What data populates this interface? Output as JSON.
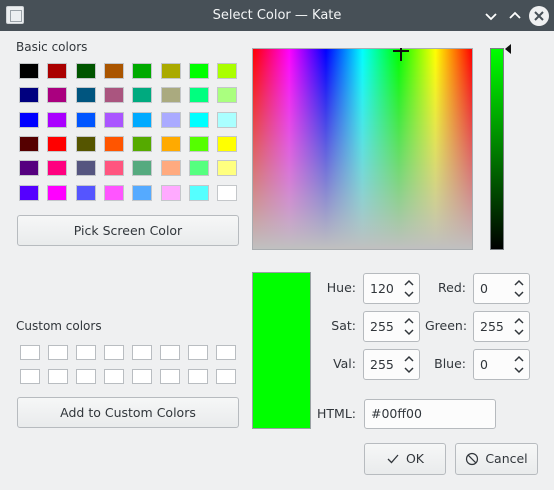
{
  "window": {
    "title": "Select Color — Kate"
  },
  "basic_colors": {
    "title": "Basic colors",
    "rows": [
      [
        "#000000",
        "#aa0000",
        "#005500",
        "#aa5500",
        "#00aa00",
        "#aaaa00",
        "#00ff00",
        "#aaff00"
      ],
      [
        "#00007f",
        "#aa007f",
        "#00557f",
        "#aa557f",
        "#00aa7f",
        "#aaaa7f",
        "#00ff7f",
        "#aaff7f"
      ],
      [
        "#0000ff",
        "#aa00ff",
        "#0055ff",
        "#aa55ff",
        "#00aaff",
        "#aaaaff",
        "#00ffff",
        "#aaffff"
      ],
      [
        "#550000",
        "#ff0000",
        "#555500",
        "#ff5500",
        "#55aa00",
        "#ffaa00",
        "#55ff00",
        "#ffff00"
      ],
      [
        "#55007f",
        "#ff007f",
        "#55557f",
        "#ff557f",
        "#55aa7f",
        "#ffaa7f",
        "#55ff7f",
        "#ffff7f"
      ],
      [
        "#5500ff",
        "#ff00ff",
        "#5555ff",
        "#ff55ff",
        "#55aaff",
        "#ffaaff",
        "#55ffff",
        "#ffffff"
      ]
    ],
    "pick_button": "Pick Screen Color"
  },
  "custom_colors": {
    "title": "Custom colors",
    "rows": [
      [
        "#ffffff",
        "#ffffff",
        "#ffffff",
        "#ffffff",
        "#ffffff",
        "#ffffff",
        "#ffffff",
        "#ffffff"
      ],
      [
        "#ffffff",
        "#ffffff",
        "#ffffff",
        "#ffffff",
        "#ffffff",
        "#ffffff",
        "#ffffff",
        "#ffffff"
      ]
    ],
    "add_button": "Add to Custom Colors"
  },
  "current_color": "#00ff00",
  "fields": {
    "hue": {
      "label": "Hue:",
      "value": "120"
    },
    "sat": {
      "label": "Sat:",
      "value": "255"
    },
    "val": {
      "label": "Val:",
      "value": "255"
    },
    "red": {
      "label": "Red:",
      "value": "0"
    },
    "green": {
      "label": "Green:",
      "value": "255"
    },
    "blue": {
      "label": "Blue:",
      "value": "0"
    },
    "html": {
      "label": "HTML:",
      "value": "#00ff00"
    }
  },
  "buttons": {
    "ok": "OK",
    "cancel": "Cancel"
  },
  "icons": {
    "app": "window-icon",
    "minimize": "chevron-down-icon",
    "maximize": "chevron-up-icon",
    "close": "close-icon",
    "ok": "checkmark-icon",
    "cancel": "cancel-icon"
  }
}
